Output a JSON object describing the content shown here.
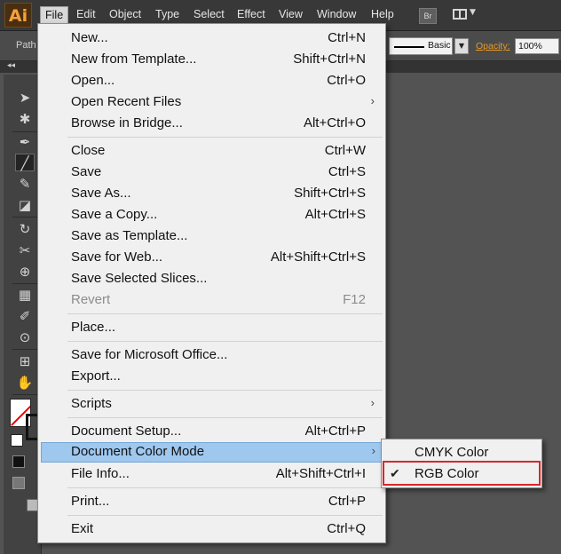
{
  "app": {
    "logo": "Ai"
  },
  "menubar": {
    "items": [
      "File",
      "Edit",
      "Object",
      "Type",
      "Select",
      "Effect",
      "View",
      "Window",
      "Help"
    ],
    "bridge_button": "Br"
  },
  "controlbar": {
    "selection_type": "Path",
    "stroke_style": "Basic",
    "opacity_label": "Opacity:",
    "opacity_value": "100%"
  },
  "file_menu": {
    "items": [
      {
        "label": "New...",
        "shortcut": "Ctrl+N"
      },
      {
        "label": "New from Template...",
        "shortcut": "Shift+Ctrl+N"
      },
      {
        "label": "Open...",
        "shortcut": "Ctrl+O"
      },
      {
        "label": "Open Recent Files",
        "shortcut": ""
      },
      {
        "label": "Browse in Bridge...",
        "shortcut": "Alt+Ctrl+O"
      },
      {
        "label": "Close",
        "shortcut": "Ctrl+W"
      },
      {
        "label": "Save",
        "shortcut": "Ctrl+S"
      },
      {
        "label": "Save As...",
        "shortcut": "Shift+Ctrl+S"
      },
      {
        "label": "Save a Copy...",
        "shortcut": "Alt+Ctrl+S"
      },
      {
        "label": "Save as Template...",
        "shortcut": ""
      },
      {
        "label": "Save for Web...",
        "shortcut": "Alt+Shift+Ctrl+S"
      },
      {
        "label": "Save Selected Slices...",
        "shortcut": ""
      },
      {
        "label": "Revert",
        "shortcut": "F12"
      },
      {
        "label": "Place...",
        "shortcut": ""
      },
      {
        "label": "Save for Microsoft Office...",
        "shortcut": ""
      },
      {
        "label": "Export...",
        "shortcut": ""
      },
      {
        "label": "Scripts",
        "shortcut": ""
      },
      {
        "label": "Document Setup...",
        "shortcut": "Alt+Ctrl+P"
      },
      {
        "label": "Document Color Mode",
        "shortcut": ""
      },
      {
        "label": "File Info...",
        "shortcut": "Alt+Shift+Ctrl+I"
      },
      {
        "label": "Print...",
        "shortcut": "Ctrl+P"
      },
      {
        "label": "Exit",
        "shortcut": "Ctrl+Q"
      }
    ]
  },
  "color_mode_submenu": {
    "items": [
      {
        "label": "CMYK Color",
        "checked": false
      },
      {
        "label": "RGB Color",
        "checked": true
      }
    ],
    "highlight_color": "#d9262e"
  },
  "colors": {
    "menu_highlight": "#9fc8ef",
    "opacity_label": "#e59a28",
    "logo": "#f7a13a"
  }
}
